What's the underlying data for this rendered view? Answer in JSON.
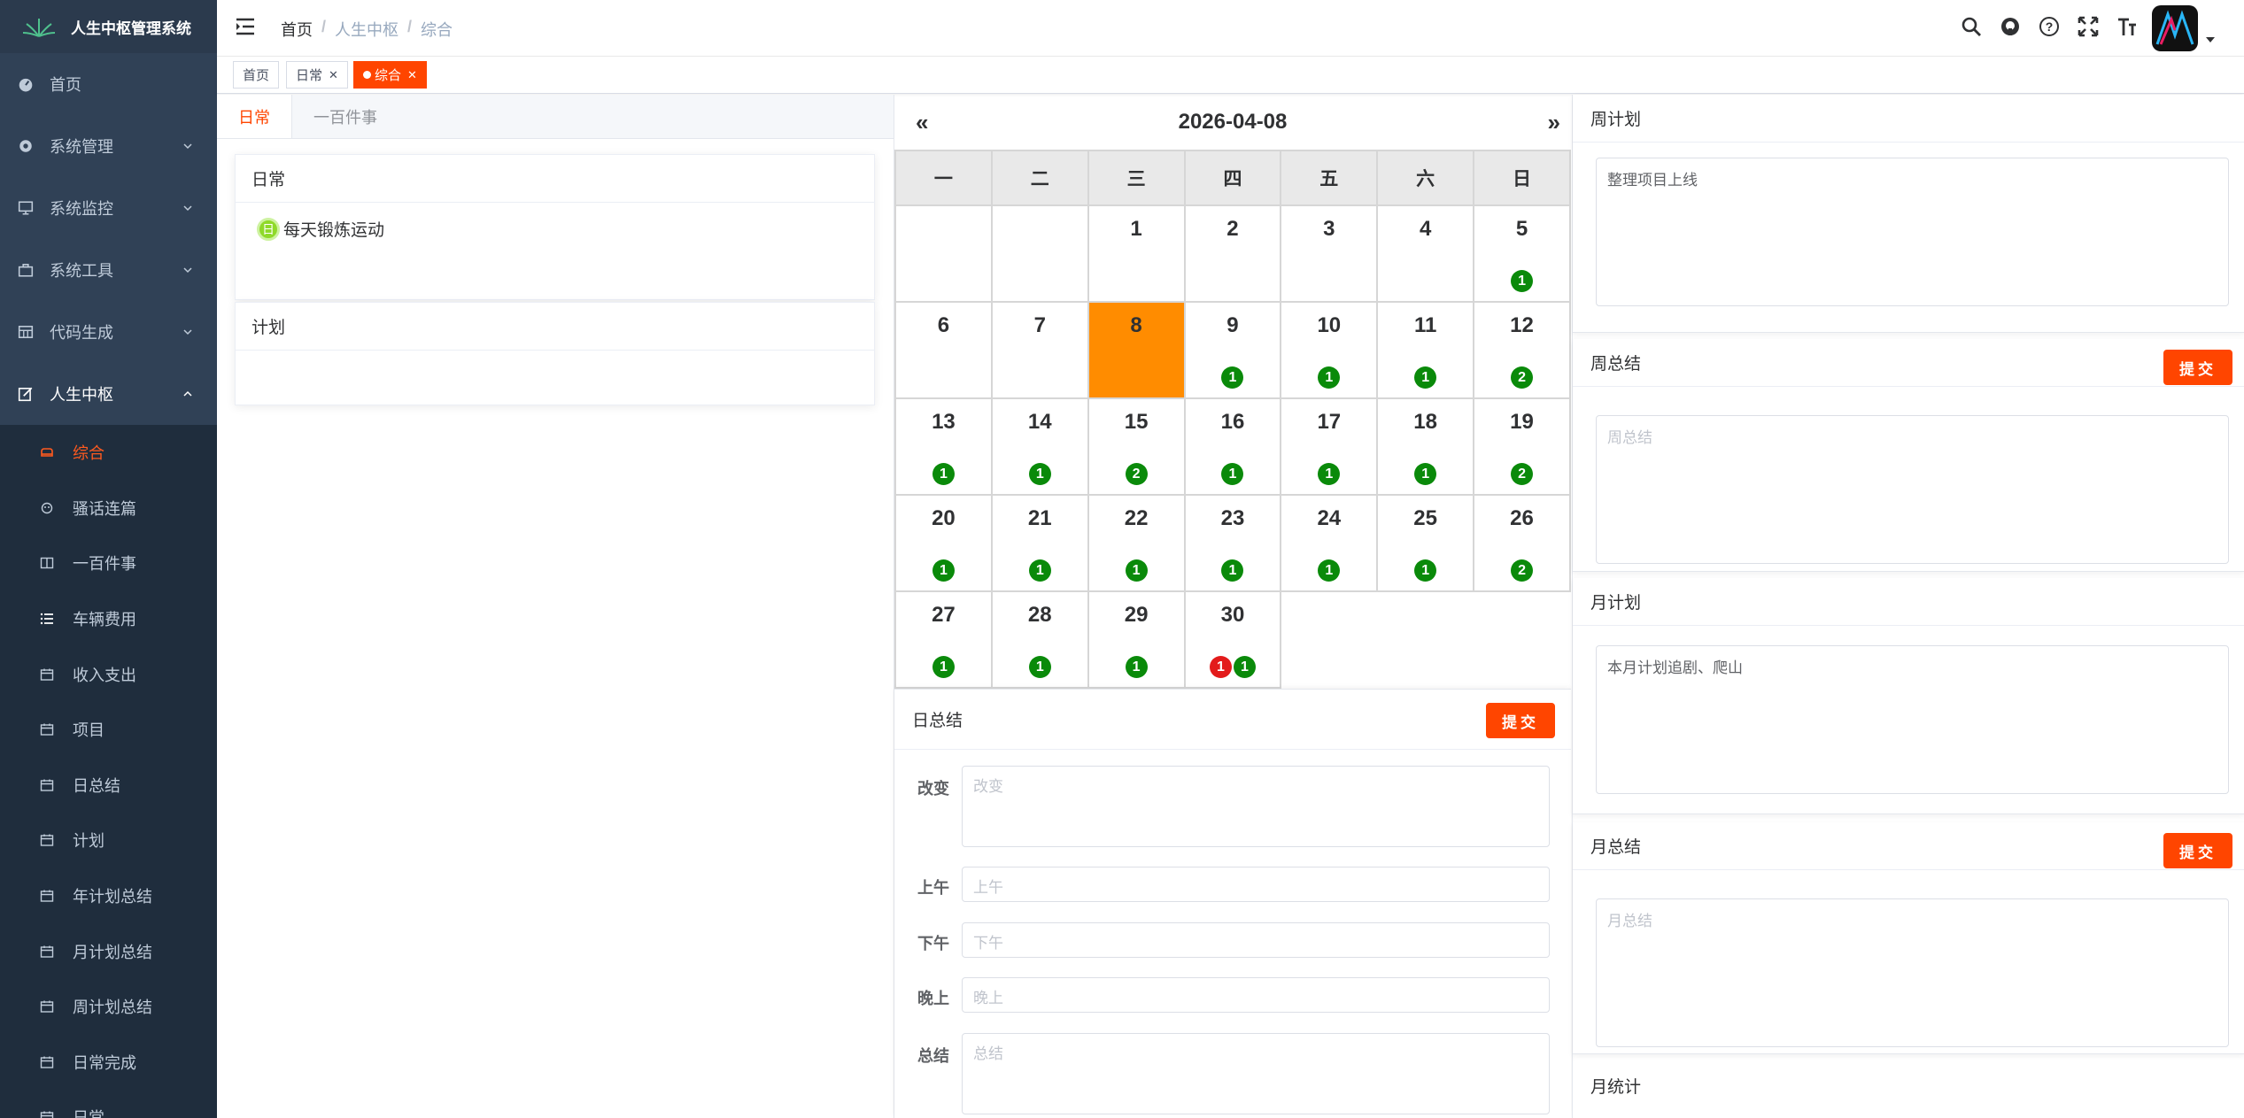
{
  "app": {
    "title": "人生中枢管理系统"
  },
  "sidebar": {
    "items": [
      {
        "label": "首页",
        "icon": "dashboard-icon"
      },
      {
        "label": "系统管理",
        "icon": "gear-icon"
      },
      {
        "label": "系统监控",
        "icon": "monitor-icon"
      },
      {
        "label": "系统工具",
        "icon": "toolbox-icon"
      },
      {
        "label": "代码生成",
        "icon": "table-icon"
      },
      {
        "label": "人生中枢",
        "icon": "edit-icon"
      }
    ],
    "sub": [
      {
        "label": "综合",
        "icon": "sofa-icon"
      },
      {
        "label": "骚话连篇",
        "icon": "chat-icon"
      },
      {
        "label": "一百件事",
        "icon": "book-icon"
      },
      {
        "label": "车辆费用",
        "icon": "list-icon"
      },
      {
        "label": "收入支出",
        "icon": "calendar-icon"
      },
      {
        "label": "项目",
        "icon": "calendar-icon"
      },
      {
        "label": "日总结",
        "icon": "calendar-icon"
      },
      {
        "label": "计划",
        "icon": "calendar-icon"
      },
      {
        "label": "年计划总结",
        "icon": "calendar-icon"
      },
      {
        "label": "月计划总结",
        "icon": "calendar-icon"
      },
      {
        "label": "周计划总结",
        "icon": "calendar-icon"
      },
      {
        "label": "日常完成",
        "icon": "calendar-icon"
      },
      {
        "label": "日常",
        "icon": "calendar-icon"
      }
    ]
  },
  "breadcrumb": [
    "首页",
    "人生中枢",
    "综合"
  ],
  "tags": [
    {
      "label": "首页"
    },
    {
      "label": "日常"
    },
    {
      "label": "综合"
    }
  ],
  "left": {
    "tabs": [
      "日常",
      "一百件事"
    ],
    "daily_title": "日常",
    "daily_badge": "日",
    "daily_item": "每天锻炼运动",
    "plan_title": "计划"
  },
  "calendar": {
    "title": "2026-04-08",
    "prev": "«",
    "next": "»",
    "weekdays": [
      "一",
      "二",
      "三",
      "四",
      "五",
      "六",
      "日"
    ],
    "today": "8",
    "weeks": [
      [
        null,
        null,
        {
          "d": "1"
        },
        {
          "d": "2"
        },
        {
          "d": "3"
        },
        {
          "d": "4"
        },
        {
          "d": "5",
          "g": "1"
        }
      ],
      [
        {
          "d": "6"
        },
        {
          "d": "7"
        },
        {
          "d": "8"
        },
        {
          "d": "9",
          "g": "1"
        },
        {
          "d": "10",
          "g": "1"
        },
        {
          "d": "11",
          "g": "1"
        },
        {
          "d": "12",
          "g": "2"
        }
      ],
      [
        {
          "d": "13",
          "g": "1"
        },
        {
          "d": "14",
          "g": "1"
        },
        {
          "d": "15",
          "g": "2"
        },
        {
          "d": "16",
          "g": "1"
        },
        {
          "d": "17",
          "g": "1"
        },
        {
          "d": "18",
          "g": "1"
        },
        {
          "d": "19",
          "g": "2"
        }
      ],
      [
        {
          "d": "20",
          "g": "1"
        },
        {
          "d": "21",
          "g": "1"
        },
        {
          "d": "22",
          "g": "1"
        },
        {
          "d": "23",
          "g": "1"
        },
        {
          "d": "24",
          "g": "1"
        },
        {
          "d": "25",
          "g": "1"
        },
        {
          "d": "26",
          "g": "2"
        }
      ],
      [
        {
          "d": "27",
          "g": "1"
        },
        {
          "d": "28",
          "g": "1"
        },
        {
          "d": "29",
          "g": "1"
        },
        {
          "d": "30",
          "r": "1",
          "g": "1"
        },
        null,
        null,
        null
      ]
    ]
  },
  "daily_summary": {
    "title": "日总结",
    "submit": "提交",
    "fields": [
      {
        "label": "改变",
        "placeholder": "改变"
      },
      {
        "label": "上午",
        "placeholder": "上午"
      },
      {
        "label": "下午",
        "placeholder": "下午"
      },
      {
        "label": "晚上",
        "placeholder": "晚上"
      },
      {
        "label": "总结",
        "placeholder": "总结"
      }
    ]
  },
  "right": {
    "week_plan": {
      "title": "周计划",
      "value": "整理项目上线"
    },
    "week_summary": {
      "title": "周总结",
      "submit": "提交",
      "placeholder": "周总结"
    },
    "month_plan": {
      "title": "月计划",
      "value": "本月计划追剧、爬山"
    },
    "month_summary": {
      "title": "月总结",
      "submit": "提交",
      "placeholder": "月总结"
    },
    "month_stats": {
      "title": "月统计"
    }
  },
  "colors": {
    "accent": "#ff4500",
    "sidebar": "#304156",
    "today": "#ff8c00",
    "badge_green": "#0a8a0a",
    "badge_red": "#e31b1b"
  }
}
